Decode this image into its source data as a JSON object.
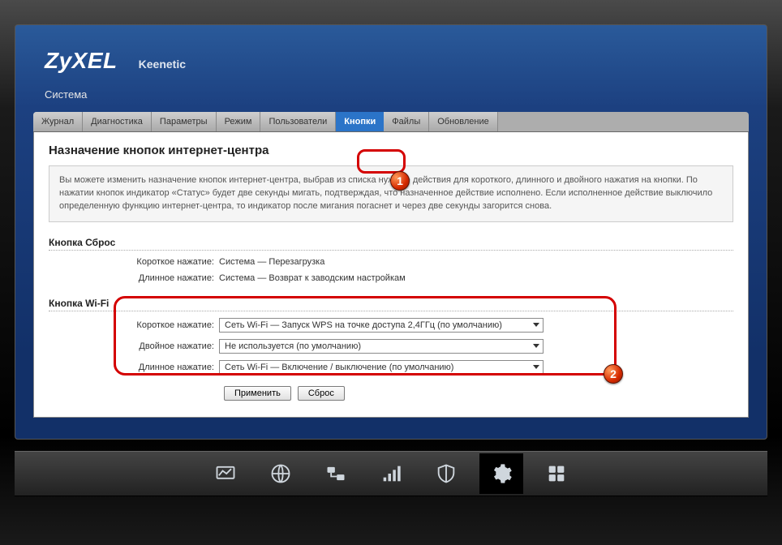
{
  "brand": "ZyXEL",
  "model": "Keenetic",
  "system_label": "Система",
  "tabs": [
    "Журнал",
    "Диагностика",
    "Параметры",
    "Режим",
    "Пользователи",
    "Кнопки",
    "Файлы",
    "Обновление"
  ],
  "active_tab_index": 5,
  "page_title": "Назначение кнопок интернет-центра",
  "help_text": "Вы можете изменить назначение кнопок интернет-центра, выбрав из списка нужные действия для короткого, длинного и двойного нажатия на кнопки. По нажатии кнопок индикатор «Статус» будет две секунды мигать, подтверждая, что назначенное действие исполнено. Если исполненное действие выключило определенную функцию интернет-центра, то индикатор после мигания погаснет и через две секунды загорится снова.",
  "reset_button": {
    "heading": "Кнопка Сброс",
    "rows": [
      {
        "label": "Короткое нажатие:",
        "value": "Система — Перезагрузка"
      },
      {
        "label": "Длинное нажатие:",
        "value": "Система — Возврат к заводским настройкам"
      }
    ]
  },
  "wifi_button": {
    "heading": "Кнопка Wi-Fi",
    "rows": [
      {
        "label": "Короткое нажатие:",
        "value": "Сеть Wi-Fi — Запуск WPS на точке доступа 2,4ГГц (по умолчанию)"
      },
      {
        "label": "Двойное нажатие:",
        "value": "Не используется (по умолчанию)"
      },
      {
        "label": "Длинное нажатие:",
        "value": "Сеть Wi-Fi — Включение / выключение (по умолчанию)"
      }
    ]
  },
  "buttons": {
    "apply": "Применить",
    "reset": "Сброс"
  },
  "annotations": {
    "badge1": "1",
    "badge2": "2"
  },
  "taskbar_icons": [
    "monitor",
    "globe",
    "network",
    "signal",
    "shield",
    "gear",
    "apps"
  ],
  "taskbar_active_index": 5
}
